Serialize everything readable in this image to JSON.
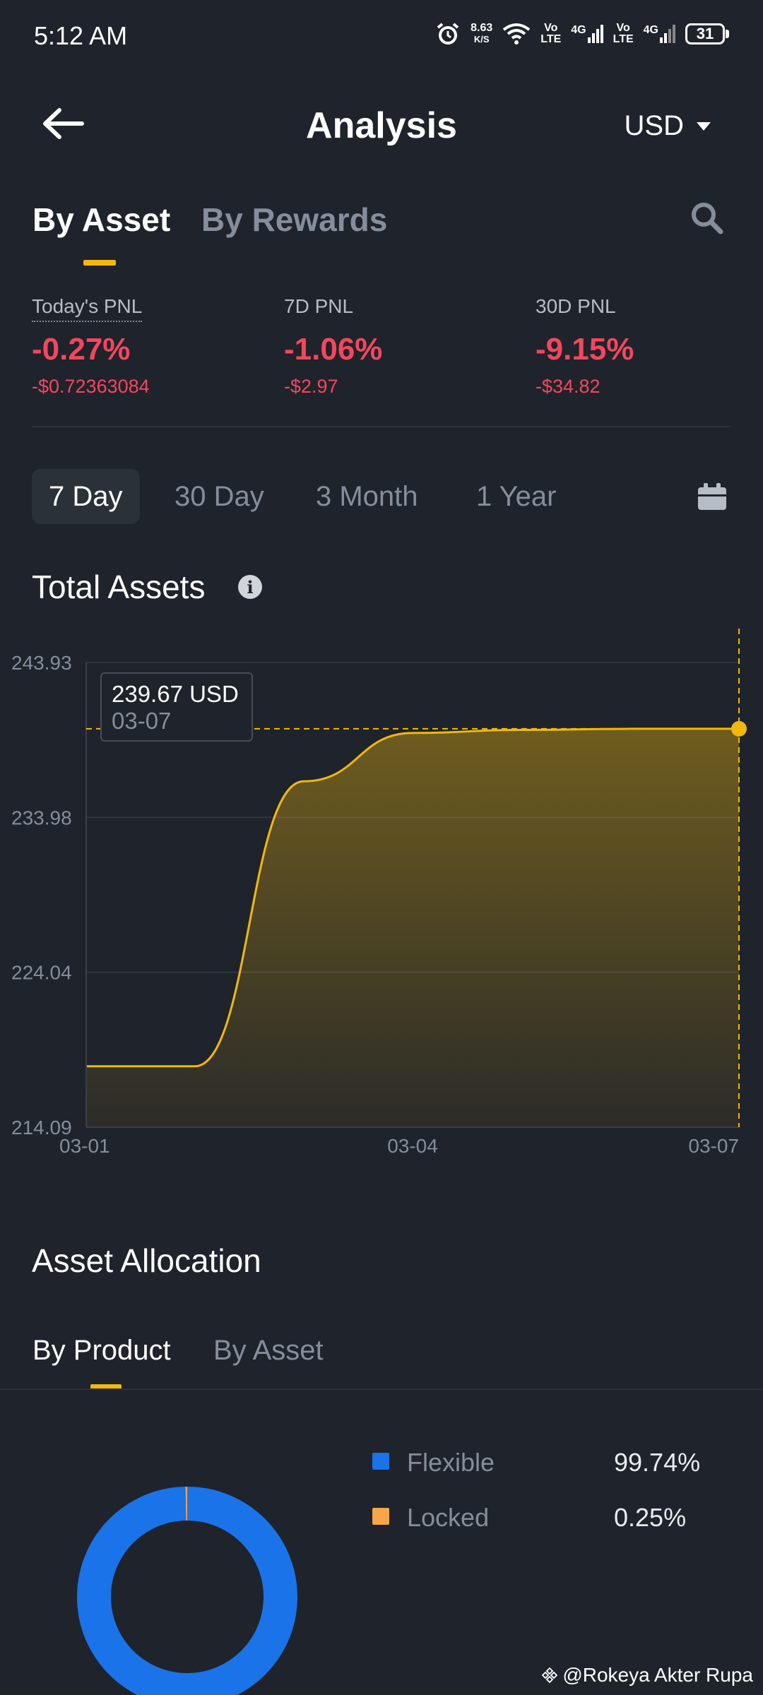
{
  "status_bar": {
    "time": "5:12 AM",
    "net_speed_value": "8.63",
    "net_speed_unit": "K/S",
    "sim1_top": "Vo",
    "sim1_bottom": "LTE",
    "sim1_gen": "4G",
    "sim2_top": "Vo",
    "sim2_bottom": "LTE",
    "sim2_gen": "4G",
    "battery": "31"
  },
  "header": {
    "title": "Analysis",
    "currency": "USD"
  },
  "top_tabs": {
    "items": [
      {
        "label": "By Asset",
        "active": true
      },
      {
        "label": "By Rewards",
        "active": false
      }
    ]
  },
  "pnl": [
    {
      "label": "Today's PNL",
      "percent": "-0.27%",
      "value": "-$0.72363084"
    },
    {
      "label": "7D PNL",
      "percent": "-1.06%",
      "value": "-$2.97"
    },
    {
      "label": "30D PNL",
      "percent": "-9.15%",
      "value": "-$34.82"
    }
  ],
  "ranges": {
    "items": [
      "7 Day",
      "30 Day",
      "3 Month",
      "1 Year"
    ],
    "selected": "7 Day"
  },
  "total_assets": {
    "title": "Total Assets"
  },
  "colors": {
    "accent": "#f0b90b",
    "negative": "#f6465d",
    "flexible": "#1a73e8",
    "locked": "#f7a648",
    "background": "#1f232b"
  },
  "chart_data": {
    "type": "area",
    "x": [
      "03-01",
      "03-02",
      "03-03",
      "03-04",
      "03-05",
      "03-06",
      "03-07"
    ],
    "values": [
      218.0,
      218.0,
      236.3,
      239.4,
      239.6,
      239.67,
      239.67
    ],
    "yticks": [
      "243.93",
      "233.98",
      "224.04",
      "214.09"
    ],
    "ylim": [
      214.09,
      243.93
    ],
    "xticks": [
      "03-01",
      "03-04",
      "03-07"
    ],
    "tooltip": {
      "value": "239.67 USD",
      "date": "03-07"
    },
    "grid": true,
    "color": "#f0b90b"
  },
  "asset_allocation": {
    "title": "Asset Allocation",
    "tabs": [
      {
        "label": "By Product",
        "active": true
      },
      {
        "label": "By Asset",
        "active": false
      }
    ],
    "legend": [
      {
        "label": "Flexible",
        "value": "99.74%",
        "percent": 99.74
      },
      {
        "label": "Locked",
        "value": "0.25%",
        "percent": 0.25
      }
    ]
  },
  "watermark": "@Rokeya Akter Rupa"
}
